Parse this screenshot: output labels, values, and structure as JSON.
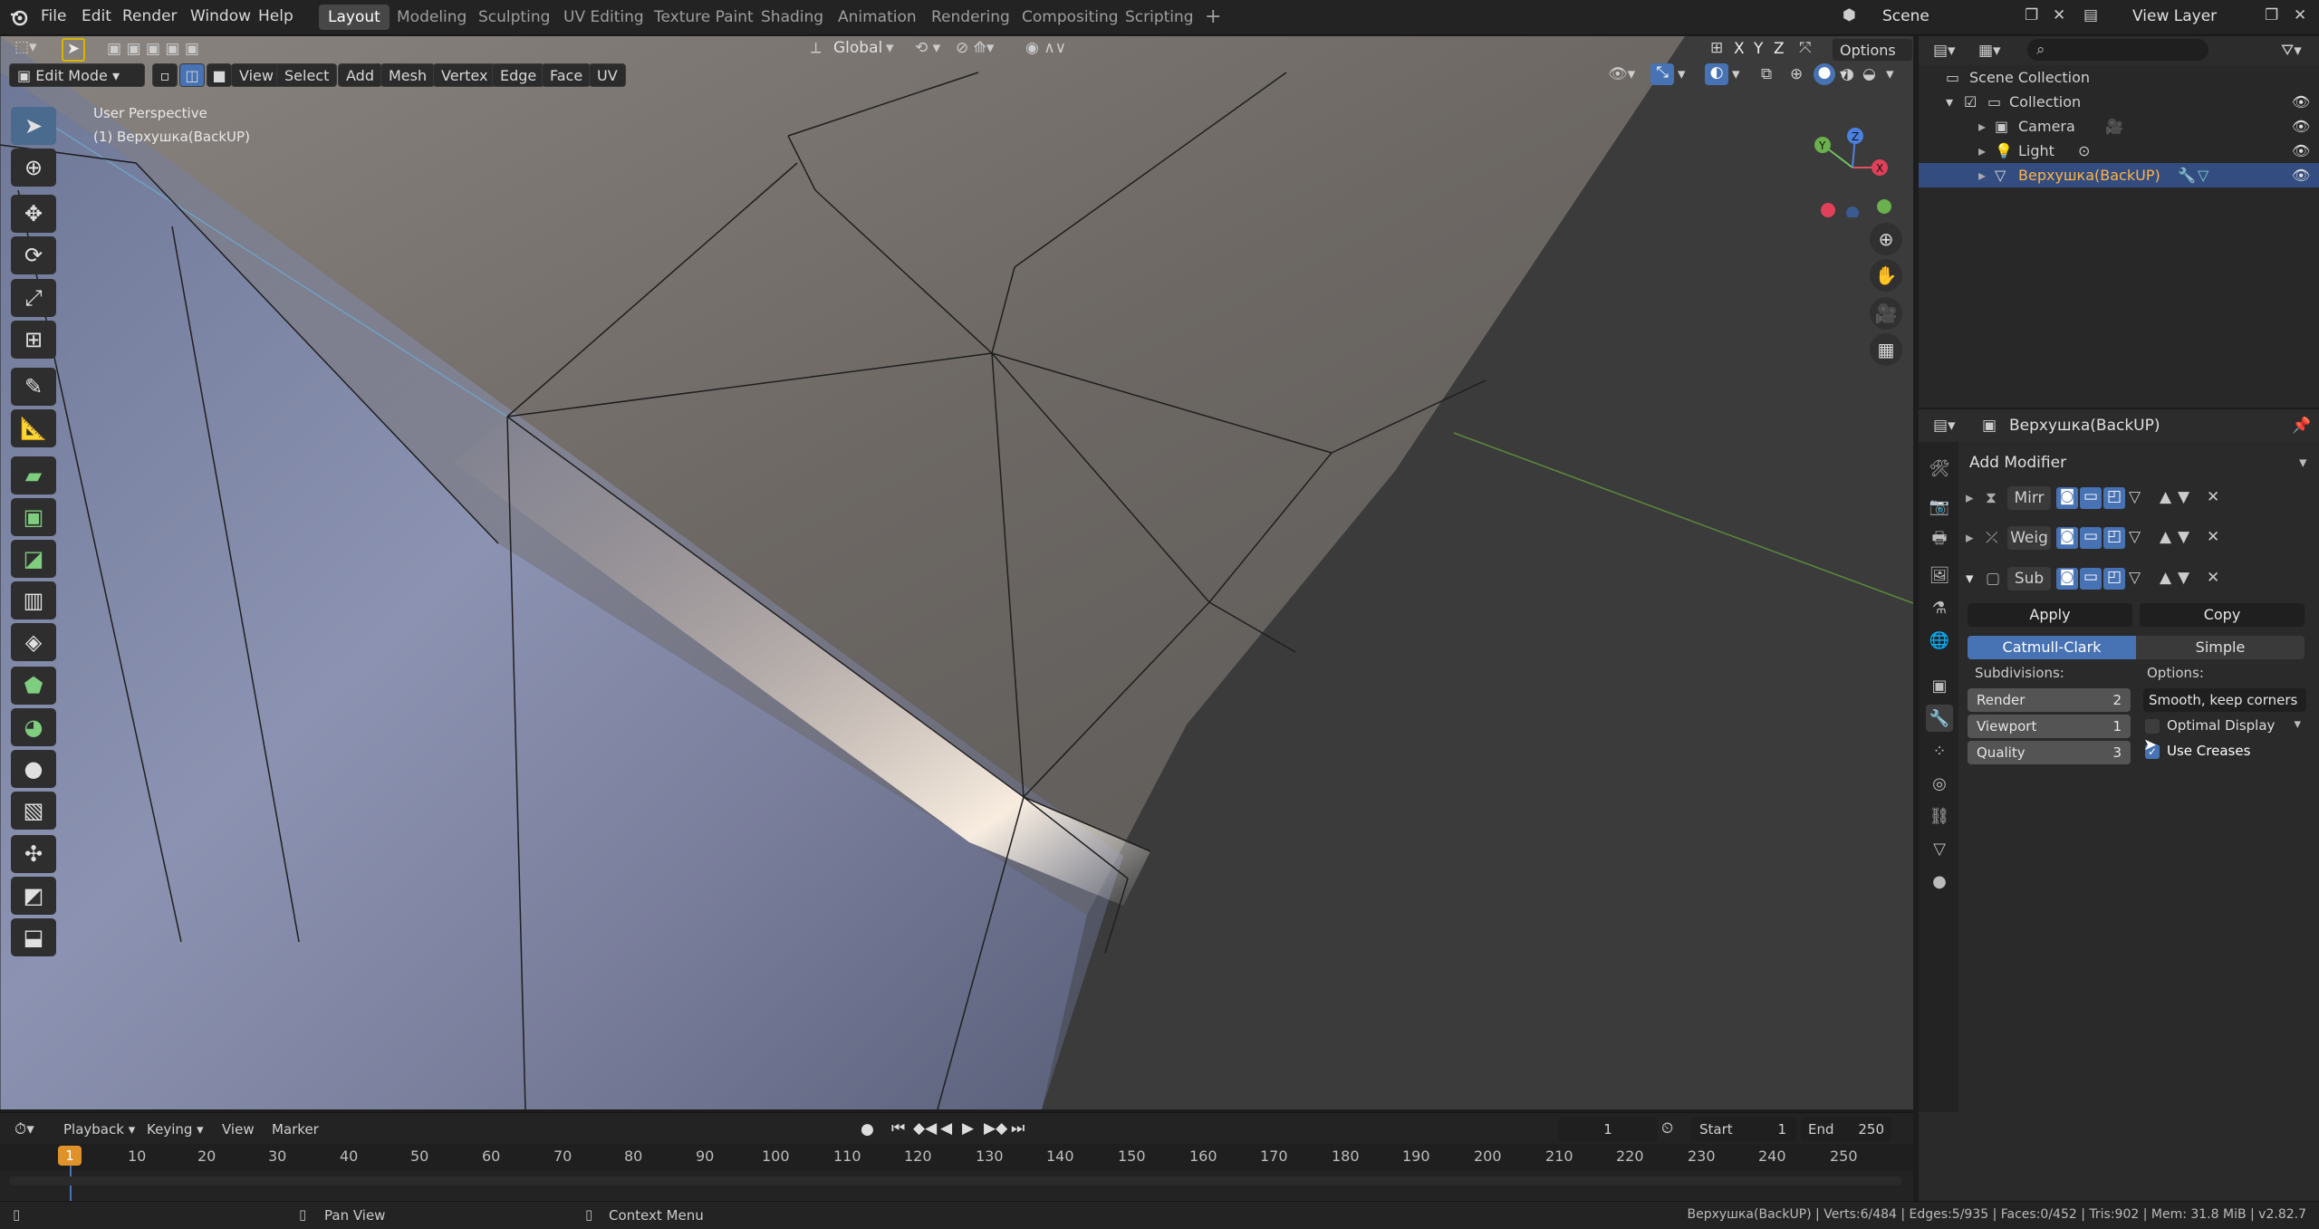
{
  "topbar": {
    "menus": [
      "File",
      "Edit",
      "Render",
      "Window",
      "Help"
    ],
    "workspaces": [
      "Layout",
      "Modeling",
      "Sculpting",
      "UV Editing",
      "Texture Paint",
      "Shading",
      "Animation",
      "Rendering",
      "Compositing",
      "Scripting"
    ],
    "active_workspace": "Layout",
    "scene": "Scene",
    "view_layer": "View Layer"
  },
  "viewport_header": {
    "mode": "Edit Mode",
    "menus": [
      "View",
      "Select",
      "Add",
      "Mesh",
      "Vertex",
      "Edge",
      "Face",
      "UV"
    ],
    "orientation": "Global",
    "options": "Options",
    "axes": [
      "X",
      "Y",
      "Z"
    ]
  },
  "viewport": {
    "perspective": "User Perspective",
    "object_label": "(1) Верхушка(BackUP)",
    "gizmo_axes": [
      "X",
      "Y",
      "Z"
    ]
  },
  "outliner": {
    "root": "Scene Collection",
    "collection": "Collection",
    "items": [
      "Camera",
      "Light",
      "Верхушка(BackUP)"
    ],
    "selected": "Верхушка(BackUP)"
  },
  "properties": {
    "object_name": "Верхушка(BackUP)",
    "add_modifier": "Add Modifier",
    "modifiers": [
      {
        "name": "Mirr",
        "expanded": false
      },
      {
        "name": "Weig",
        "expanded": false
      },
      {
        "name": "Sub",
        "expanded": true
      }
    ],
    "apply": "Apply",
    "copy": "Copy",
    "algorithms": [
      "Catmull-Clark",
      "Simple"
    ],
    "active_algorithm": "Catmull-Clark",
    "subdivisions_label": "Subdivisions:",
    "options_label": "Options:",
    "render_label": "Render",
    "render_value": "2",
    "viewport_label": "Viewport",
    "viewport_value": "1",
    "quality_label": "Quality",
    "quality_value": "3",
    "uv_smooth": "Smooth, keep corners",
    "optimal_display": "Optimal Display",
    "optimal_display_checked": false,
    "use_creases": "Use Creases",
    "use_creases_checked": true
  },
  "timeline": {
    "menus": [
      "Playback",
      "Keying",
      "View",
      "Marker"
    ],
    "current_frame": "1",
    "start_label": "Start",
    "start": "1",
    "end_label": "End",
    "end": "250",
    "ruler": [
      "1",
      "10",
      "20",
      "30",
      "40",
      "50",
      "60",
      "70",
      "80",
      "90",
      "100",
      "110",
      "120",
      "130",
      "140",
      "150",
      "160",
      "170",
      "180",
      "190",
      "200",
      "210",
      "220",
      "230",
      "240",
      "250"
    ]
  },
  "statusbar": {
    "pan_view": "Pan View",
    "context_menu": "Context Menu",
    "stats": "Верхушка(BackUP) | Verts:6/484 | Edges:5/935 | Faces:0/452 | Tris:902 | Mem: 31.8 MiB | v2.82.7"
  },
  "colors": {
    "accent_blue": "#4772b3",
    "selected_row": "#334d80",
    "active_tool": "#4a6a8e"
  }
}
